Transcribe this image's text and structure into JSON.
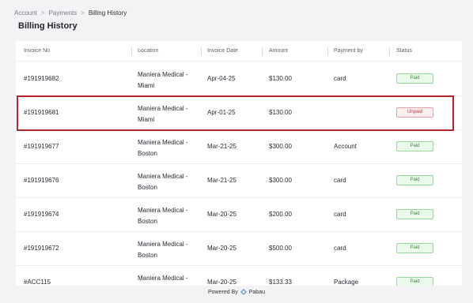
{
  "breadcrumb": {
    "items": [
      "Account",
      "Payments",
      "Billing History"
    ],
    "separator": ">"
  },
  "page": {
    "title": "Billing History"
  },
  "table": {
    "headers": [
      "Invoice No",
      "Location",
      "Invoice Date",
      "Amount",
      "Payment by",
      "Status"
    ],
    "rows": [
      {
        "invoice": "#191919682",
        "location": [
          "Maniera Medical -",
          "Miami"
        ],
        "date": "Apr-04-25",
        "amount": "$130.00",
        "payment": "card",
        "status": "Paid"
      },
      {
        "invoice": "#191919681",
        "location": [
          "Maniera Medical -",
          "Miami"
        ],
        "date": "Apr-01-25",
        "amount": "$130.00",
        "payment": "",
        "status": "Unpaid"
      },
      {
        "invoice": "#191919677",
        "location": [
          "Maniera Medical -",
          "Boston"
        ],
        "date": "Mar-21-25",
        "amount": "$300.00",
        "payment": "Account",
        "status": "Paid"
      },
      {
        "invoice": "#191919676",
        "location": [
          "Maniera Medical -",
          "Boston"
        ],
        "date": "Mar-21-25",
        "amount": "$300.00",
        "payment": "card",
        "status": "Paid"
      },
      {
        "invoice": "#191919674",
        "location": [
          "Maniera Medical -",
          "Boston"
        ],
        "date": "Mar-20-25",
        "amount": "$200.00",
        "payment": "card",
        "status": "Paid"
      },
      {
        "invoice": "#191919672",
        "location": [
          "Maniera Medical -",
          "Boston"
        ],
        "date": "Mar-20-25",
        "amount": "$500.00",
        "payment": "card",
        "status": "Paid"
      },
      {
        "invoice": "#ACC115",
        "location": [
          "Maniera Medical -",
          ""
        ],
        "date": "Mar-20-25",
        "amount": "$133.33",
        "payment": "Package",
        "status": "Paid"
      }
    ]
  },
  "footer": {
    "powered_by": "Powered By",
    "brand": "Pabau"
  },
  "colors": {
    "paid": "#3a8a3a",
    "unpaid": "#b23a3a",
    "highlight": "#b3262a",
    "logo": "#4a90d9"
  }
}
